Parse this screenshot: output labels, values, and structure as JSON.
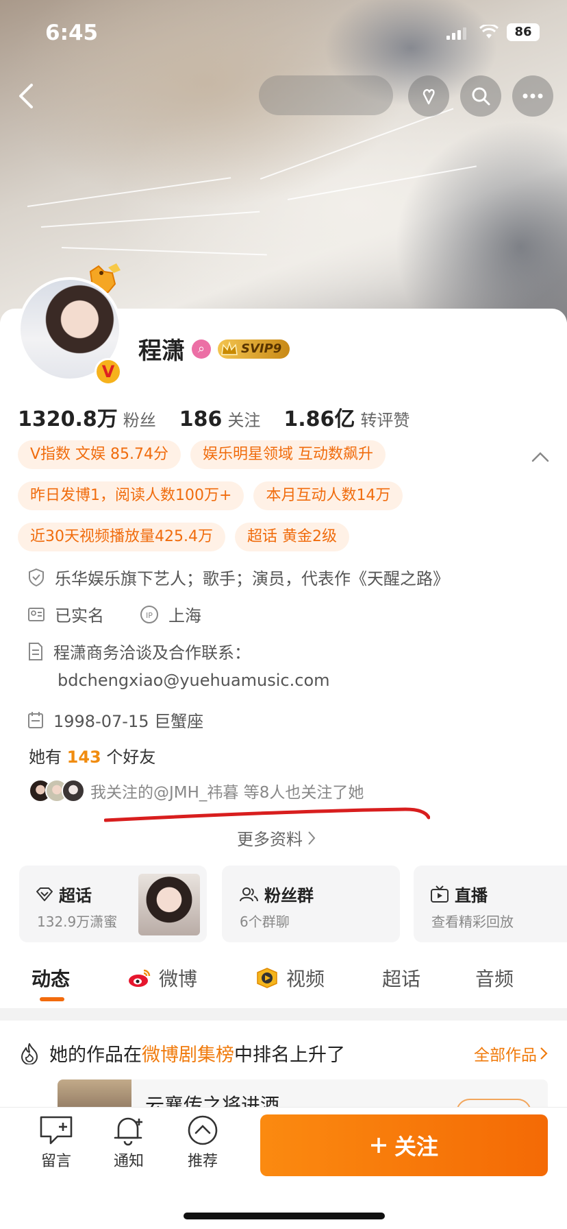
{
  "status_bar": {
    "time": "6:45",
    "battery": "86"
  },
  "profile": {
    "name": "程潇",
    "vip_badge": "SVIP9",
    "verified_glyph": "V"
  },
  "stats": [
    {
      "value": "1320.8万",
      "label": "粉丝"
    },
    {
      "value": "186",
      "label": "关注"
    },
    {
      "value": "1.86亿",
      "label": "转评赞"
    }
  ],
  "tags": {
    "row1": [
      "V指数 文娱 85.74分",
      "娱乐明星领域 互动数飙升"
    ],
    "row2": [
      "昨日发博1，阅读人数100万+",
      "本月互动人数14万"
    ],
    "row3": [
      "近30天视频播放量425.4万",
      "超话 黄金2级"
    ]
  },
  "info": {
    "agency": "乐华娱乐旗下艺人；歌手；演员，代表作《天醒之路》",
    "real_name": "已实名",
    "ip_location": "上海",
    "business_contact_label": "程潇商务洽谈及合作联系：",
    "business_contact_email": "bdchengxiao@yuehuamusic.com",
    "birthday": "1998-07-15 巨蟹座"
  },
  "friends": {
    "prefix": "她有",
    "count": "143",
    "suffix": "个好友"
  },
  "mutual_follow": "我关注的@JMH_祎暮 等8人也关注了她",
  "more_info": "更多资料",
  "features": [
    {
      "title": "超话",
      "sub": "132.9万潇蜜",
      "icon": "diamond-icon"
    },
    {
      "title": "粉丝群",
      "sub": "6个群聊",
      "icon": "group-icon"
    },
    {
      "title": "直播",
      "sub": "查看精彩回放",
      "icon": "tv-icon"
    }
  ],
  "tabs": [
    "动态",
    "微博",
    "视频",
    "超话",
    "音频"
  ],
  "rank_notice": {
    "prefix": "她的作品在",
    "highlight": "微博剧集榜",
    "suffix": "中排名上升了",
    "link": "全部作品"
  },
  "work_preview_title": "云襄传之将进酒",
  "bottom_bar": {
    "message": "留言",
    "notify": "通知",
    "recommend": "推荐",
    "follow": "关注"
  },
  "colors": {
    "accent": "#f46a05",
    "tag_bg": "#fff1e6",
    "tag_text": "#f06c0d",
    "link": "#f07b0d"
  }
}
